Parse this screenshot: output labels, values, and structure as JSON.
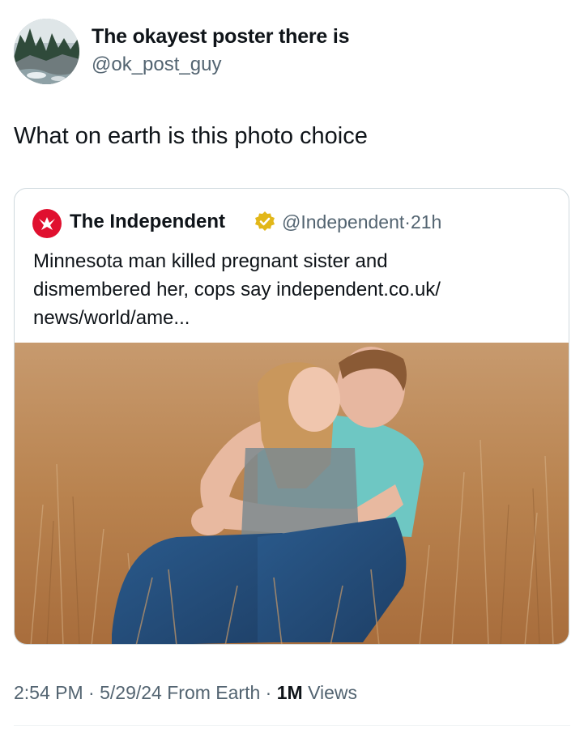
{
  "author": {
    "display_name": "The okayest poster there is",
    "handle": "@ok_post_guy",
    "avatar_icon": "avatar-landscape-icon"
  },
  "tweet": {
    "text": "What on earth is this photo choice"
  },
  "quoted_tweet": {
    "display_name": "The Independent",
    "verified_icon": "verified-badge-icon",
    "handle": "@Independent",
    "separator": "·",
    "time": "21h",
    "text_lines": [
      "Minnesota man killed pregnant sister and",
      "dismembered her, cops say independent.co.uk/",
      "news/world/ame..."
    ],
    "logo_icon": "independent-eagle-icon",
    "brand_color": "#e0102f",
    "photo_icon": "couple-in-field-photo"
  },
  "meta": {
    "time": "2:54 PM",
    "dot1": "·",
    "date": "5/29/24",
    "source": "From Earth",
    "dot2": "·",
    "views_count": "1M",
    "views_label": "Views"
  },
  "colors": {
    "text_primary": "#0f1419",
    "text_secondary": "#536471",
    "border": "#cfd9de",
    "verified_gold": "#e2b719"
  }
}
